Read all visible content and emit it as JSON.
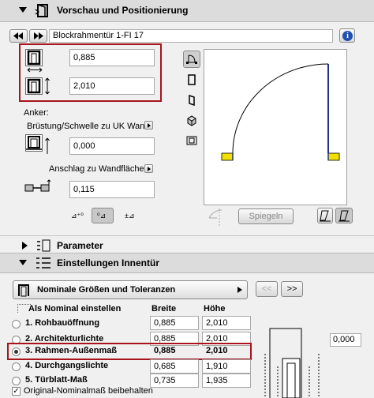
{
  "sections": {
    "preview": "Vorschau und Positionierung",
    "parameter": "Parameter",
    "settings": "Einstellungen Innentür"
  },
  "door_name": "Blockrahmentür 1-FI 17",
  "info_icon": "i",
  "width_value": "0,885",
  "height_value": "2,010",
  "anker_label": "Anker:",
  "bruestung_label": "Brüstung/Schwelle zu UK Wand",
  "bruestung_value": "0,000",
  "anschlag_label": "Anschlag zu Wandfläche",
  "anschlag_value": "0,115",
  "spiegeln_label": "Spiegeln",
  "nominal_dropdown": "Nominale Größen und Toleranzen",
  "nav_prev": "<<",
  "nav_next": ">>",
  "table": {
    "header_label": "Als Nominal einstellen",
    "col_breite": "Breite",
    "col_hoehe": "Höhe",
    "rows": [
      {
        "label": "1. Rohbauöffnung",
        "breite": "0,885",
        "hoehe": "2,010",
        "selected": false
      },
      {
        "label": "2. Architekturlichte",
        "breite": "0,885",
        "hoehe": "2,010",
        "selected": false
      },
      {
        "label": "3. Rahmen-Außenmaß",
        "breite": "0,885",
        "hoehe": "2,010",
        "selected": true
      },
      {
        "label": "4. Durchgangslichte",
        "breite": "0,685",
        "hoehe": "1,910",
        "selected": false
      },
      {
        "label": "5. Türblatt-Maß",
        "breite": "0,735",
        "hoehe": "1,935",
        "selected": false
      }
    ]
  },
  "right_value": "0,000",
  "checkbox_label": "Original-Nominalmaß beibehalten",
  "colors": {
    "highlight": "#a8141c",
    "accent": "#1f2f8a",
    "door_base": "#f0e000",
    "info": "#1f4fb0"
  }
}
